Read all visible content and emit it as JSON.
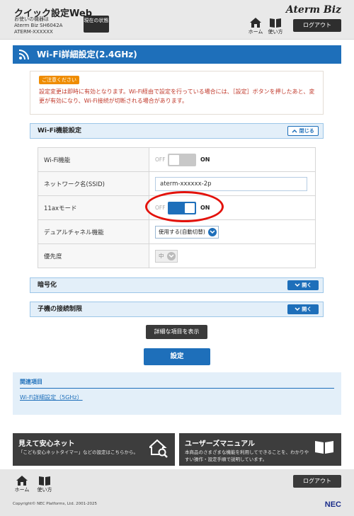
{
  "header": {
    "app_title": "クイック設定Web",
    "device_info_line1": "お使いの機器は",
    "device_info_line2": "Aterm Biz SH6042A",
    "device_info_line3": "ATERM-XXXXXX",
    "status_button": "現在の状態",
    "brand": "Aterm Biz",
    "home_label": "ホーム",
    "help_label": "使い方",
    "logout_label": "ログアウト"
  },
  "page": {
    "section_title": "Wi-Fi詳細設定(2.4GHz)"
  },
  "notice": {
    "badge": "ご注意ください",
    "text": "設定変更は即時に有効となります。Wi-Fi経由で設定を行っている場合には、［設定］ボタンを押したあと、変更が有効になり、Wi-Fi接続が切断される場合があります。"
  },
  "wifi_group": {
    "title": "Wi-Fi機能設定",
    "toggle_label": "閉じる",
    "rows": [
      {
        "label": "Wi-Fi機能"
      },
      {
        "label": "ネットワーク名(SSID)"
      },
      {
        "label": "11axモード"
      },
      {
        "label": "デュアルチャネル機能"
      },
      {
        "label": "優先度"
      }
    ],
    "wifi_switch": {
      "off": "OFF",
      "on": "ON",
      "enabled": false
    },
    "ssid_value": "aterm-xxxxxx-2p",
    "ax_switch": {
      "off": "OFF",
      "on": "ON",
      "enabled": true
    },
    "dual_channel_value": "使用する(自動切替)",
    "priority_value": "中"
  },
  "encryption_group": {
    "title": "暗号化",
    "toggle_label": "開く"
  },
  "child_group": {
    "title": "子機の接続制限",
    "toggle_label": "開く"
  },
  "buttons": {
    "show_details": "詳細な項目を表示",
    "submit": "設定"
  },
  "related": {
    "title": "関連項目",
    "link": "Wi-Fi詳細設定（5GHz）"
  },
  "cards": {
    "left_title": "見えて安心ネット",
    "left_desc": "「こども安心ネットタイマー」などの設定はこちらから。",
    "right_title": "ユーザーズマニュアル",
    "right_desc": "本商品のさまざまな機能を利用してできることを、わかりやすい操作・設定手順で説明しています。"
  },
  "footer": {
    "home_label": "ホーム",
    "help_label": "使い方",
    "logout_label": "ログアウト",
    "copyright": "Copyright© NEC Platforms, Ltd. 2001-2025",
    "logo": "NEC"
  },
  "colors": {
    "accent": "#1e6fba",
    "highlight_ring": "#e3120b",
    "notice_badge": "#ef8c00",
    "notice_text": "#c0392b"
  },
  "icons": [
    "wifi-icon",
    "home-icon",
    "book-icon",
    "house-search-icon",
    "chevron-up-icon",
    "chevron-down-icon"
  ]
}
